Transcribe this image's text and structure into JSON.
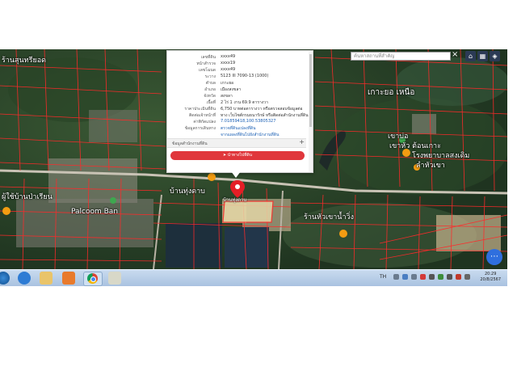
{
  "map": {
    "places": [
      "ร้านสุนทรียอด",
      "เกาะยอ เหนือ",
      "เขาบ่อ",
      "บ้านหัวเขา",
      "บ้านทุ่งดาบ",
      "เขาหัว ต้อนเกาะ",
      "โรงพยาบาลสงเดิม",
      "ลำหัวเขา",
      "ผู้ใช้บ้านป่าเรียน",
      "Palcoom Ban",
      "ร้านหัวเขาน้ำวิ่ง"
    ],
    "pin_caption": "บ้านทุ่งดาบ"
  },
  "popup": {
    "rows": [
      {
        "label": "เลขที่ดิน",
        "value": "xxxx49"
      },
      {
        "label": "หน้าสำรวจ",
        "value": "xxxx19"
      },
      {
        "label": "เลขโฉนด",
        "value": "xxxx49"
      },
      {
        "label": "ระวาง",
        "value": "5123 III 7090-13 (1000)"
      },
      {
        "label": "ตำบล",
        "value": "เกาะยอ"
      },
      {
        "label": "อำเภอ",
        "value": "เมืองสงขลา"
      },
      {
        "label": "จังหวัด",
        "value": "สงขลา"
      },
      {
        "label": "เนื้อที่",
        "value": "2 ไร่ 1 งาน 69.9 ตารางวา"
      },
      {
        "label": "ราคาประเมินที่ดิน",
        "value": "6,750 บาทต่อตารางวา หรือตรวจสอบข้อมูลต่อ"
      },
      {
        "label": "ติดต่อเจ้าหน้าที่",
        "value": "ทาง เว็บไซต์กรมธนารักษ์ หรือติดต่อสำนักงานที่ดิน"
      },
      {
        "label": "ค่าพิกัดแปลง",
        "value": "7.01859418,100.53805327",
        "link": true
      },
      {
        "label": "ข้อมูลการเดินทาง",
        "value": "ตรวจที่ดินแปลงที่ดิน",
        "link": true
      },
      {
        "label": "",
        "value": "จากแผลงที่ดินไปยังสำนักงานที่ดิน",
        "link": true
      }
    ],
    "section_title": "ข้อมูลสำนักงานที่ดิน",
    "section_toggle": "+",
    "nav_button": "นำทางไปที่ดิน",
    "nav_icon": "navigation-icon"
  },
  "search": {
    "placeholder": "ค้นหาสถานที่สำคัญ",
    "close": "×"
  },
  "map_controls": [
    "home-icon",
    "grid-icon",
    "layers-icon"
  ],
  "map_controls_symbols": [
    "⌂",
    "▦",
    "◈"
  ],
  "float_button_icon": "more-icon",
  "float_button_symbol": "⋯",
  "taskbar": {
    "language": "TH",
    "time": "20:29",
    "date": "20/8/2567"
  },
  "colors": {
    "parcel_line": "#ff2a2a",
    "nav_button": "#e0373c",
    "link": "#1a5fb4",
    "fab": "#2f6fde"
  }
}
